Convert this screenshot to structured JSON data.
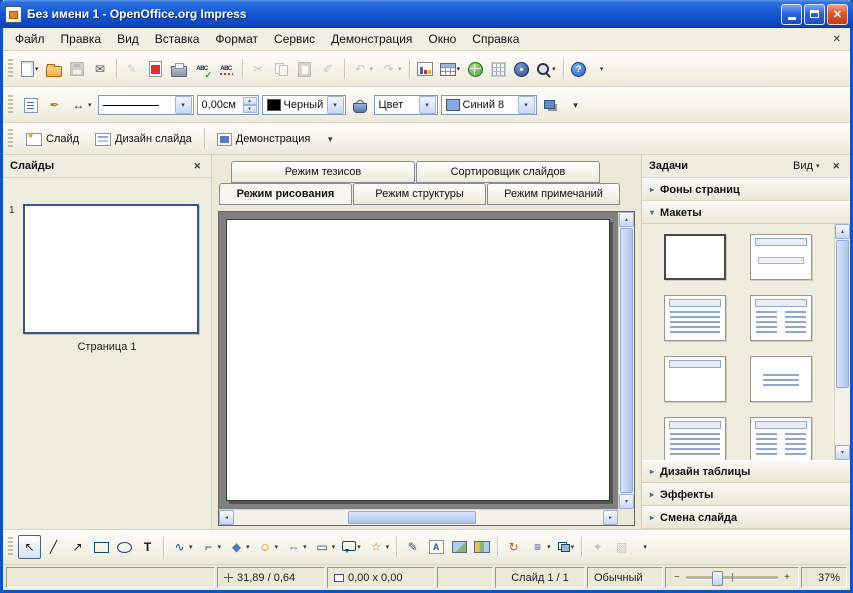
{
  "window": {
    "title": "Без имени 1 - OpenOffice.org Impress"
  },
  "menubar": {
    "items": [
      "Файл",
      "Правка",
      "Вид",
      "Вставка",
      "Формат",
      "Сервис",
      "Демонстрация",
      "Окно",
      "Справка"
    ]
  },
  "toolbar_standard": {
    "icons": [
      {
        "n": "new-document",
        "c": "i-page",
        "dd": true
      },
      {
        "n": "open",
        "c": "i-folder"
      },
      {
        "n": "save",
        "c": "i-disk",
        "dis": true
      },
      {
        "n": "document-as-email",
        "g": "✉",
        "col": "#556"
      },
      {
        "sep": true
      },
      {
        "n": "edit-file",
        "g": "✎",
        "col": "#888",
        "dis": true
      },
      {
        "n": "export-pdf",
        "c": "i-pdf"
      },
      {
        "n": "print",
        "c": "i-print"
      },
      {
        "n": "spellcheck",
        "c": "i-spell",
        "g": "ABC"
      },
      {
        "n": "auto-spellcheck",
        "c": "i-autospell",
        "g": "ABC"
      },
      {
        "sep": true
      },
      {
        "n": "cut",
        "g": "✂",
        "col": "#778",
        "dis": true
      },
      {
        "n": "copy",
        "c": "i-copy",
        "dis": true
      },
      {
        "n": "paste",
        "c": "i-paste",
        "dis": true
      },
      {
        "n": "format-paintbrush",
        "g": "✐",
        "col": "#778",
        "dis": true
      },
      {
        "sep": true
      },
      {
        "n": "undo",
        "g": "↶",
        "col": "#B08830",
        "dis": true,
        "dd": true
      },
      {
        "n": "redo",
        "g": "↷",
        "col": "#5A8A4A",
        "dis": true,
        "dd": true
      },
      {
        "sep": true
      },
      {
        "n": "insert-chart",
        "c": "i-chart"
      },
      {
        "n": "insert-table",
        "c": "i-table",
        "dd": true
      },
      {
        "n": "hyperlink",
        "c": "i-globe"
      },
      {
        "n": "display-grid",
        "c": "i-grid"
      },
      {
        "n": "navigator",
        "c": "i-nav"
      },
      {
        "n": "zoom",
        "c": "i-zoom",
        "dd": true
      },
      {
        "sep": true
      },
      {
        "n": "help",
        "c": "i-help",
        "g": "?"
      },
      {
        "n": "toolbar-options",
        "g": "",
        "dd": true
      }
    ]
  },
  "toolbar_line_fill": {
    "left_icons": [
      {
        "n": "styles-formatting",
        "c": "i-styles"
      },
      {
        "n": "line-dialog",
        "g": "✒",
        "col": "#B08820"
      },
      {
        "n": "arrow-style",
        "g": "↔",
        "col": "#334",
        "dd": true
      }
    ],
    "width_value": "0,00см",
    "line_color_label": "Черный",
    "fill_style_label": "Цвет",
    "fill_color_label": "Синий 8"
  },
  "toolbar_presentation": {
    "slide_label": "Слайд",
    "design_label": "Дизайн слайда",
    "slideshow_label": "Демонстрация"
  },
  "slides_panel": {
    "title": "Слайды",
    "slide_number": "1",
    "page_caption": "Страница 1"
  },
  "view_tabs": {
    "row_top": [
      "Режим тезисов",
      "Сортировщик слайдов"
    ],
    "row_bottom": [
      "Режим рисования",
      "Режим структуры",
      "Режим примечаний"
    ],
    "active": "Режим рисования"
  },
  "tasks_panel": {
    "title": "Задачи",
    "view_menu_label": "Вид",
    "sections": [
      {
        "label": "Фоны страниц",
        "state": "collapsed",
        "arrow": "▸"
      },
      {
        "label": "Макеты",
        "state": "expanded",
        "arrow": "▾"
      },
      {
        "label": "Дизайн таблицы",
        "state": "collapsed",
        "arrow": "▸"
      },
      {
        "label": "Эффекты",
        "state": "collapsed",
        "arrow": "▸"
      },
      {
        "label": "Смена слайда",
        "state": "collapsed",
        "arrow": "▸"
      }
    ],
    "layouts": [
      {
        "name": "layout-blank",
        "kind": "blank",
        "selected": true
      },
      {
        "name": "layout-title-subtitle",
        "kind": "titlesub"
      },
      {
        "name": "layout-title-content",
        "kind": "list"
      },
      {
        "name": "layout-title-two-content",
        "kind": "twolist"
      },
      {
        "name": "layout-title-only",
        "kind": "titleonly"
      },
      {
        "name": "layout-centered-text",
        "kind": "center"
      },
      {
        "name": "layout-title-content-2",
        "kind": "list"
      },
      {
        "name": "layout-title-two-content-2",
        "kind": "twolist"
      }
    ]
  },
  "drawing_toolbar": {
    "icons": [
      {
        "n": "select",
        "g": "↖",
        "col": "#111",
        "pressed": true
      },
      {
        "n": "line",
        "g": "╱",
        "col": "#111"
      },
      {
        "n": "line-arrow-end",
        "g": "↗",
        "col": "#111"
      },
      {
        "n": "rectangle",
        "c": "g-rect"
      },
      {
        "n": "ellipse",
        "c": "g-ellipse"
      },
      {
        "n": "text",
        "c": "g-text",
        "g": "T",
        "col": "#111"
      },
      {
        "sep": true
      },
      {
        "n": "curve",
        "g": "∿",
        "col": "#0E4C78",
        "dd": true
      },
      {
        "n": "connector",
        "c": "g-flip",
        "g": "¬",
        "col": "#0E4C78",
        "dd": true
      },
      {
        "n": "basic-shapes",
        "g": "◆",
        "col": "#4A7AC0",
        "dd": true
      },
      {
        "n": "symbol-shapes",
        "g": "☺",
        "col": "#C89818",
        "dd": true
      },
      {
        "n": "block-arrows",
        "g": "⇔",
        "col": "#4A7AC0",
        "dd": true
      },
      {
        "n": "flowchart",
        "g": "▭",
        "col": "#0E4C78",
        "dd": true
      },
      {
        "n": "callouts",
        "c": "g-callout",
        "dd": true
      },
      {
        "n": "stars",
        "g": "☆",
        "col": "#C89818",
        "dd": true
      },
      {
        "sep": true
      },
      {
        "n": "edit-points",
        "g": "✎",
        "col": "#456"
      },
      {
        "n": "fontwork",
        "c": "g-fontwork",
        "g": "A"
      },
      {
        "n": "insert-picture",
        "c": "g-pic"
      },
      {
        "n": "gallery",
        "c": "g-gallery"
      },
      {
        "sep": true
      },
      {
        "n": "rotate",
        "g": "↻",
        "col": "#B06020"
      },
      {
        "n": "alignment",
        "g": "≡",
        "col": "#335588",
        "dd": true
      },
      {
        "n": "arrange",
        "c": "g-arrange",
        "dd": true
      },
      {
        "sep": true
      },
      {
        "n": "interaction",
        "g": "✦",
        "col": "#778",
        "dis": true
      },
      {
        "n": "extrusion",
        "g": "▧",
        "col": "#778",
        "dis": true
      },
      {
        "n": "toolbar-options",
        "g": "",
        "dd": true
      }
    ]
  },
  "statusbar": {
    "position": "31,89 / 0,64",
    "object_size": "0,00 x 0,00",
    "slide_indicator": "Слайд 1 / 1",
    "layout_name": "Обычный",
    "zoom_percent": "37%"
  },
  "colors": {
    "titlebar_blue": "#1556D4",
    "close_button_red": "#D9541E",
    "selection_border_blue": "#35568E",
    "line_color_swatch": "#000000",
    "fill_color_swatch": "#85A9E6",
    "canvas_gray": "#808080"
  }
}
